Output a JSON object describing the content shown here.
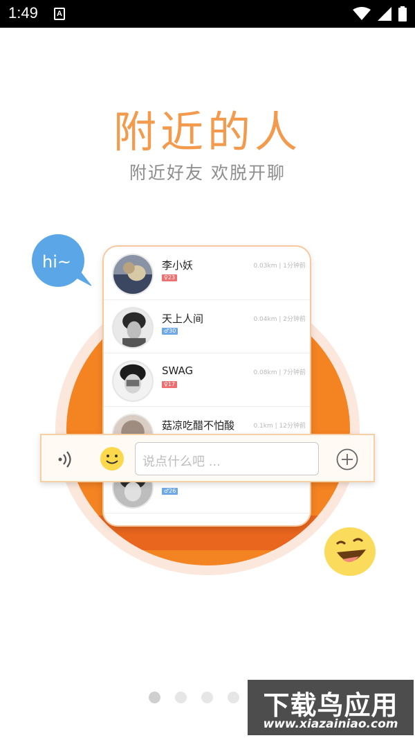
{
  "status_bar": {
    "time": "1:49",
    "notification_icon": "A"
  },
  "hero": {
    "title": "附近的人",
    "subtitle": "附近好友  欢脱开聊"
  },
  "bubble": {
    "text": "hi~"
  },
  "contacts": [
    {
      "name": "李小妖",
      "distance": "0.03km",
      "time": "1分钟前",
      "badge": "♀23",
      "gender": "female"
    },
    {
      "name": "天上人间",
      "distance": "0.04km",
      "time": "2分钟前",
      "badge": "♂30",
      "gender": "male"
    },
    {
      "name": "SWAG",
      "distance": "0.08km",
      "time": "7分钟前",
      "badge": "♀17",
      "gender": "female"
    },
    {
      "name": "菇凉吃醋不怕酸",
      "distance": "0.1km",
      "time": "12分钟前",
      "badge": "",
      "gender": "female"
    },
    {
      "name": "",
      "distance": "",
      "time": "",
      "badge": "♂26",
      "gender": "male"
    }
  ],
  "chat_bar": {
    "placeholder": "说点什么吧 ..."
  },
  "pager": {
    "count": 4,
    "active_index": 0
  },
  "watermark": {
    "title": "下载鸟应用",
    "url": "www.xiazainiao.com"
  },
  "colors": {
    "accent": "#f39a4c",
    "circle": "#f48322",
    "female_badge": "#ee6f6f",
    "male_badge": "#6ea8e6"
  }
}
